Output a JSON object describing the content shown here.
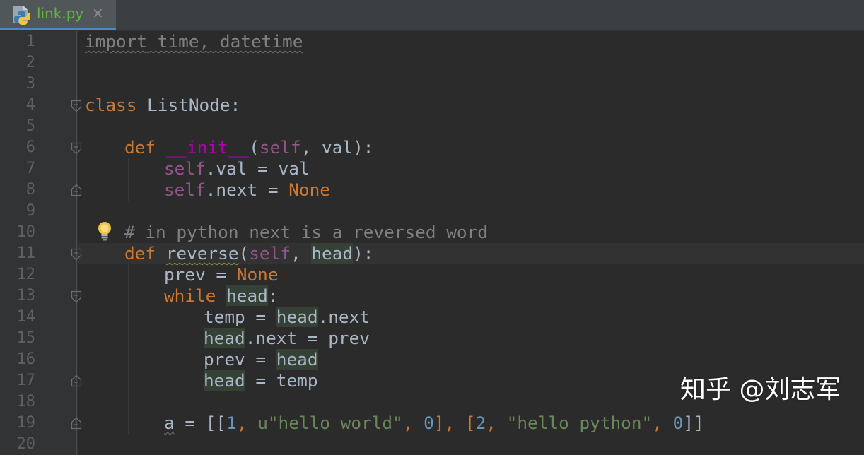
{
  "tab": {
    "name": "link.py",
    "close": "×",
    "icon": "python-file-icon"
  },
  "gutter": {
    "line_numbers": [
      "1",
      "2",
      "3",
      "4",
      "5",
      "6",
      "7",
      "8",
      "9",
      "10",
      "11",
      "12",
      "13",
      "14",
      "15",
      "16",
      "17",
      "18",
      "19",
      "20"
    ]
  },
  "code": {
    "l1": {
      "imp": "import",
      "mods": "time, datetime"
    },
    "l4": {
      "kw": "class",
      "name": " ListNode:"
    },
    "l6": {
      "kw": "def",
      "name": "__init__",
      "open": "(",
      "self": "self",
      "rest": ", val):"
    },
    "l7": {
      "self": "self",
      "rest": ".val = val"
    },
    "l8": {
      "self": "self",
      "mid": ".next = ",
      "none": "None"
    },
    "l10": {
      "comment": "# in python next is a reversed word"
    },
    "l11": {
      "kw": "def",
      "name": "reverse",
      "open": "(",
      "self": "self",
      "sep": ", ",
      "head": "head",
      "close": "):"
    },
    "l12": {
      "a": "prev = ",
      "none": "None"
    },
    "l13": {
      "kw": "while",
      "head": "head",
      "colon": ":"
    },
    "l14": {
      "a": "temp = ",
      "head": "head",
      "b": ".next"
    },
    "l15": {
      "head": "head",
      "b": ".next = prev"
    },
    "l16": {
      "a": "prev = ",
      "head": "head"
    },
    "l17": {
      "head": "head",
      "b": " = temp"
    },
    "l19": {
      "var": "a",
      "eq": " = [[",
      "n1": "1",
      "c1": ", ",
      "s1": "u\"hello world\"",
      "c2": ", ",
      "n2": "0",
      "c3": "], [",
      "n3": "2",
      "c4": ", ",
      "s2": "\"hello python\"",
      "c5": ", ",
      "n4": "0",
      "end": "]]"
    }
  },
  "watermark": "知乎 @刘志军",
  "colors": {
    "background": "#2b2b2b",
    "keyword": "#cc7832",
    "self": "#94558d",
    "string": "#6a8759",
    "number": "#6897bb",
    "comment": "#808080",
    "tab_text": "#62b543"
  }
}
